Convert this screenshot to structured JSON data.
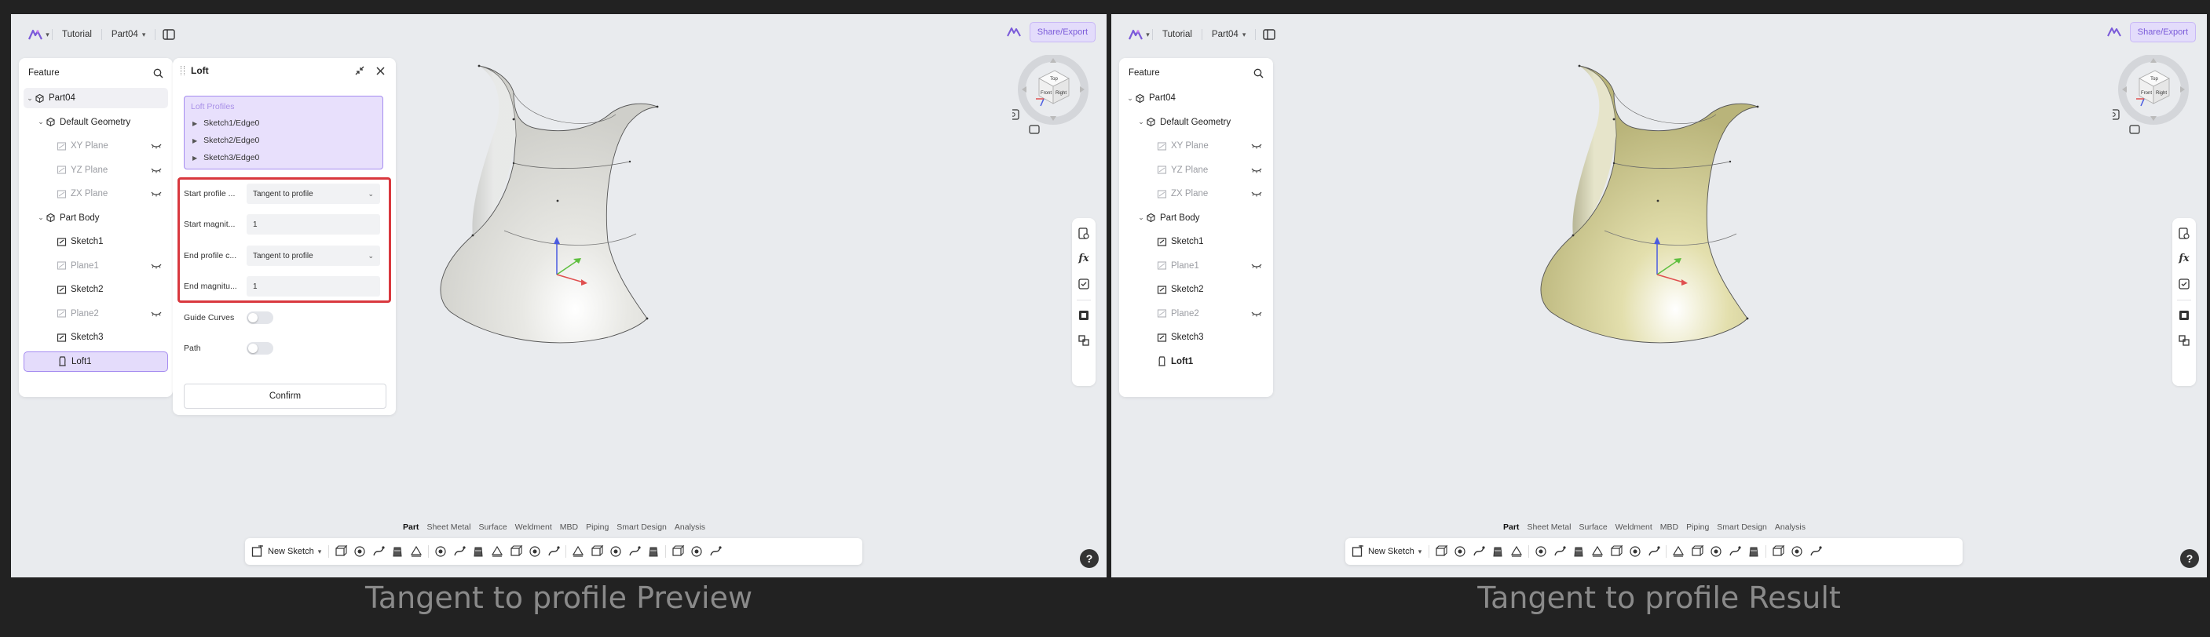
{
  "panels": [
    {
      "id": "preview",
      "caption": "Tangent to profile  Preview",
      "surface_fill": "#e8e8e4",
      "show_loft_panel": true
    },
    {
      "id": "result",
      "caption": "Tangent to profile  Result",
      "surface_fill": "#e3dfad",
      "show_loft_panel": false
    }
  ],
  "topbar": {
    "crumb_project": "Tutorial",
    "crumb_part": "Part04",
    "share_label": "Share/Export"
  },
  "feature_tree": {
    "title": "Feature",
    "items": [
      {
        "label": "Part04",
        "level": 0,
        "expander": "v",
        "icon": "part-icon",
        "muted": false
      },
      {
        "label": "Default Geometry",
        "level": 1,
        "expander": "v",
        "icon": "geometry-folder-icon",
        "muted": false
      },
      {
        "label": "XY Plane",
        "level": 2,
        "icon": "plane-icon",
        "muted": true,
        "eye": true
      },
      {
        "label": "YZ Plane",
        "level": 2,
        "icon": "plane-icon",
        "muted": true,
        "eye": true
      },
      {
        "label": "ZX Plane",
        "level": 2,
        "icon": "plane-icon",
        "muted": true,
        "eye": true
      },
      {
        "label": "Part Body",
        "level": 1,
        "expander": "v",
        "icon": "body-icon",
        "muted": false
      },
      {
        "label": "Sketch1",
        "level": 2,
        "icon": "sketch-icon",
        "muted": false
      },
      {
        "label": "Plane1",
        "level": 2,
        "icon": "plane-icon",
        "muted": true,
        "eye": true
      },
      {
        "label": "Sketch2",
        "level": 2,
        "icon": "sketch-icon",
        "muted": false
      },
      {
        "label": "Plane2",
        "level": 2,
        "icon": "plane-icon",
        "muted": true,
        "eye": true
      },
      {
        "label": "Sketch3",
        "level": 2,
        "icon": "sketch-icon",
        "muted": false
      },
      {
        "label": "Loft1",
        "level": 2,
        "icon": "loft-icon",
        "muted": false
      }
    ]
  },
  "loft": {
    "title": "Loft",
    "profiles_label": "Loft Profiles",
    "profiles": [
      "Sketch1/Edge0",
      "Sketch2/Edge0",
      "Sketch3/Edge0"
    ],
    "start_profile_label": "Start profile ...",
    "start_profile_value": "Tangent to profile",
    "start_magnitude_label": "Start magnit...",
    "start_magnitude_value": "1",
    "end_profile_label": "End profile c...",
    "end_profile_value": "Tangent to profile",
    "end_magnitude_label": "End magnitu...",
    "end_magnitude_value": "1",
    "guide_curves_label": "Guide Curves",
    "path_label": "Path",
    "confirm_label": "Confirm"
  },
  "mode_tabs": [
    "Part",
    "Sheet Metal",
    "Surface",
    "Weldment",
    "MBD",
    "Piping",
    "Smart Design",
    "Analysis"
  ],
  "toolbar": {
    "new_sketch_label": "New Sketch"
  },
  "view_cube": {
    "face_front": "Front",
    "face_right": "Right",
    "face_top": "Top"
  },
  "colors": {
    "accent": "#7a5ad9",
    "selection_border": "#a58cf0",
    "highlight_red": "#d9383e",
    "axis_x": "#e05050",
    "axis_y": "#5fbf3f",
    "axis_z": "#4a5be0"
  }
}
